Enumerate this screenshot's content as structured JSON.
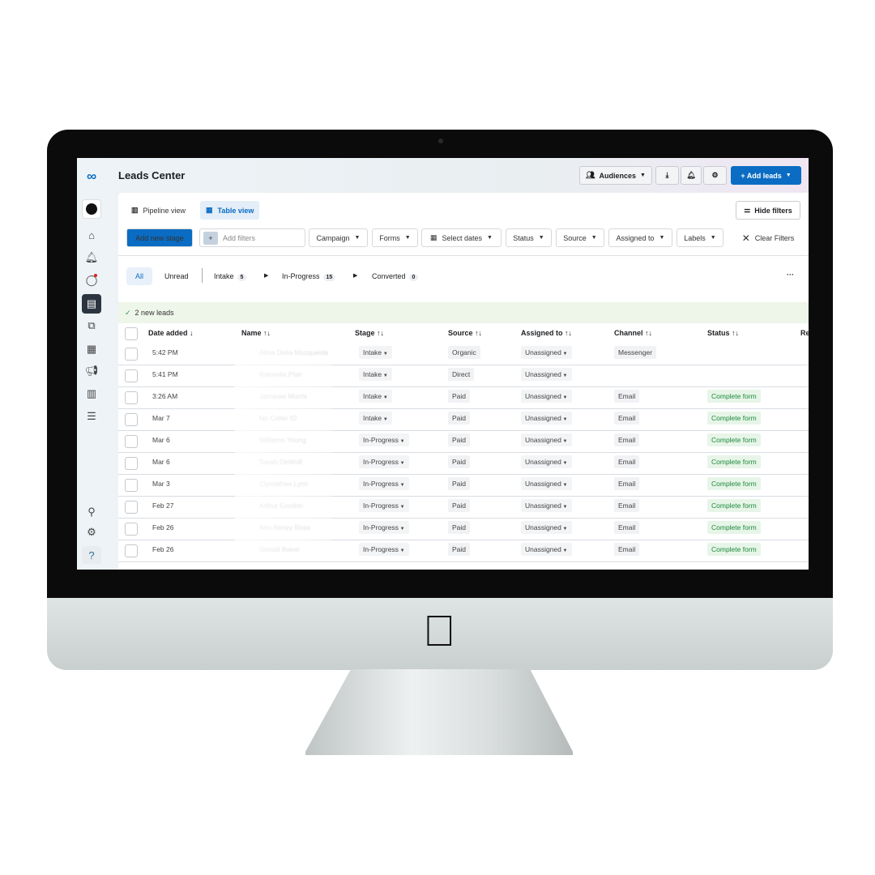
{
  "app": {
    "title": "Leads Center"
  },
  "header": {
    "audiences": "Audiences",
    "add_leads": "+ Add leads"
  },
  "views": {
    "pipeline": "Pipeline view",
    "table": "Table view",
    "hide_filters": "Hide filters"
  },
  "filters": {
    "add_stage": "Add new stage",
    "add_filters_placeholder": "Add filters",
    "campaign": "Campaign",
    "forms": "Forms",
    "dates": "Select dates",
    "status": "Status",
    "source": "Source",
    "assigned": "Assigned to",
    "labels": "Labels",
    "clear": "Clear Filters"
  },
  "tabs": {
    "all": "All",
    "unread": "Unread",
    "intake": "Intake",
    "intake_count": "5",
    "progress": "In-Progress",
    "progress_count": "15",
    "converted": "Converted",
    "converted_count": "0",
    "more": "···"
  },
  "banner": "2 new leads",
  "columns": {
    "date": "Date added ↓",
    "name": "Name ↑↓",
    "stage": "Stage ↑↓",
    "source": "Source ↑↓",
    "assigned": "Assigned to ↑↓",
    "channel": "Channel ↑↓",
    "status": "Status ↑↓",
    "re": "Re"
  },
  "rows": [
    {
      "date": "5:42 PM",
      "name": "Alma Delia Mozqueida",
      "stage": "Intake",
      "source": "Organic",
      "assigned": "Unassigned",
      "channel": "Messenger",
      "status": ""
    },
    {
      "date": "5:41 PM",
      "name": "Ralondia Plair",
      "stage": "Intake",
      "source": "Direct",
      "assigned": "Unassigned",
      "channel": "",
      "status": ""
    },
    {
      "date": "3:26 AM",
      "name": "Jamaree Morris",
      "stage": "Intake",
      "source": "Paid",
      "assigned": "Unassigned",
      "channel": "Email",
      "status": "Complete form"
    },
    {
      "date": "Mar 7",
      "name": "No Caller ID",
      "stage": "Intake",
      "source": "Paid",
      "assigned": "Unassigned",
      "channel": "Email",
      "status": "Complete form"
    },
    {
      "date": "Mar 6",
      "name": "Williams Young",
      "stage": "In-Progress",
      "source": "Paid",
      "assigned": "Unassigned",
      "channel": "Email",
      "status": "Complete form"
    },
    {
      "date": "Mar 6",
      "name": "Sarah DeWolf",
      "stage": "In-Progress",
      "source": "Paid",
      "assigned": "Unassigned",
      "channel": "Email",
      "status": "Complete form"
    },
    {
      "date": "Mar 3",
      "name": "Clymathes Lynn",
      "stage": "In-Progress",
      "source": "Paid",
      "assigned": "Unassigned",
      "channel": "Email",
      "status": "Complete form"
    },
    {
      "date": "Feb 27",
      "name": "Arthur Gordon",
      "stage": "In-Progress",
      "source": "Paid",
      "assigned": "Unassigned",
      "channel": "Email",
      "status": "Complete form"
    },
    {
      "date": "Feb 26",
      "name": "Ann Abney Ross",
      "stage": "In-Progress",
      "source": "Paid",
      "assigned": "Unassigned",
      "channel": "Email",
      "status": "Complete form"
    },
    {
      "date": "Feb 26",
      "name": "Gerald Baker",
      "stage": "In-Progress",
      "source": "Paid",
      "assigned": "Unassigned",
      "channel": "Email",
      "status": "Complete form"
    }
  ],
  "sidebar": {
    "help": "?",
    "icons": [
      "meta-logo-icon",
      "account-avatar",
      "home-icon",
      "bell-icon",
      "chat-icon",
      "leads-icon",
      "pages-icon",
      "table-icon",
      "megaphone-icon",
      "chart-icon",
      "menu-icon",
      "search-icon",
      "settings-icon",
      "help-icon"
    ]
  },
  "colors": {
    "accent": "#0a6cc2",
    "success": "#1e8a3c",
    "banner": "#eef5e9"
  }
}
